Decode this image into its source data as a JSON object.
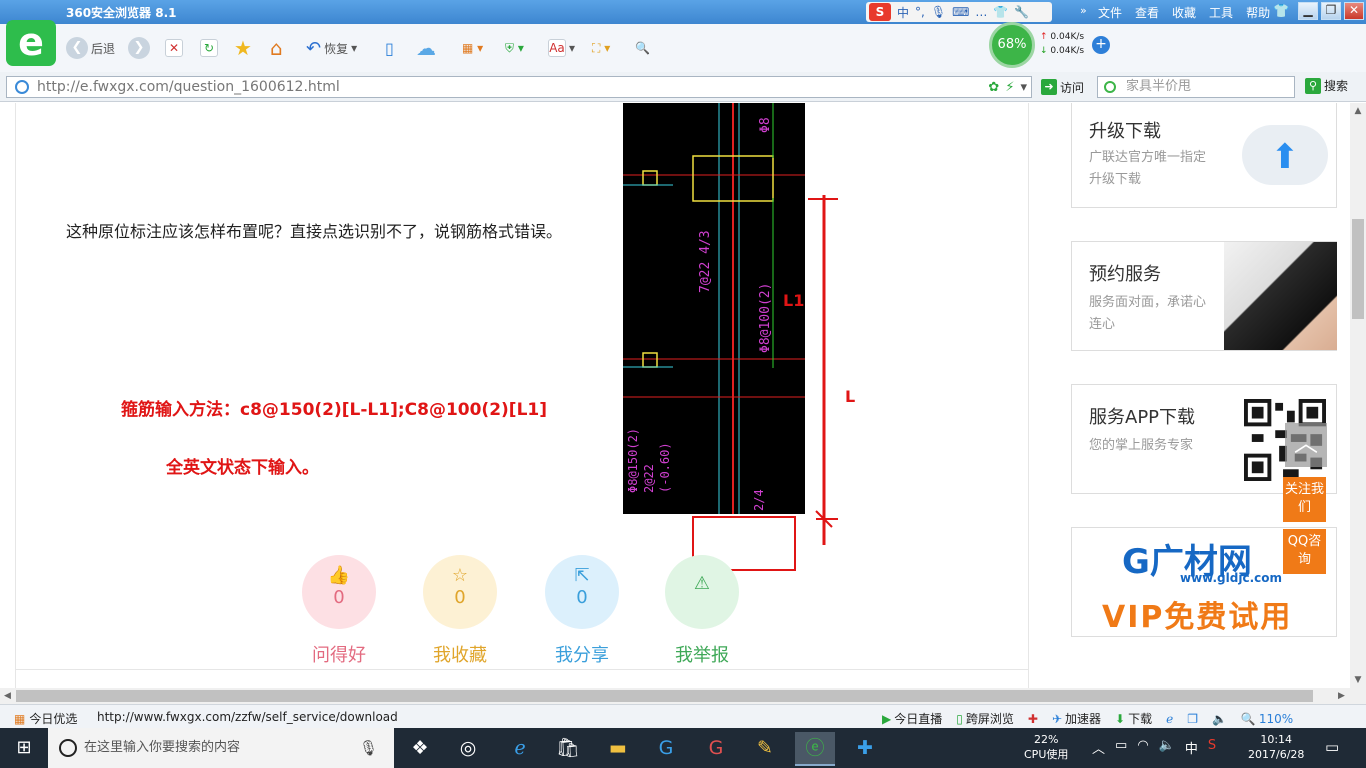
{
  "window": {
    "title": "360安全浏览器 8.1",
    "menus": [
      "文件",
      "查看",
      "收藏",
      "工具",
      "帮助"
    ],
    "controls": {
      "minimize": "▁",
      "maximize": "❐",
      "close": "✕"
    }
  },
  "ime": {
    "logo": "S",
    "mode": "中",
    "punct": "°,",
    "mic": "🎙",
    "keyboard": "⌨",
    "more": "…",
    "shirt": "👕",
    "tool": "🔧"
  },
  "toolbar": {
    "back_label": "后退",
    "restore_label": "恢复",
    "cpu_gauge": "68%",
    "net_up": "0.04K/s",
    "net_down": "0.04K/s"
  },
  "address": {
    "url": "http://e.fwxgx.com/question_1600612.html",
    "go_label": "访问",
    "search_placeholder": "家具半价甩",
    "search_button": "搜索"
  },
  "content": {
    "question_text": "这种原位标注应该怎样布置呢？直接点选识别不了，说钢筋格式错误。",
    "annotation_l1": "L1",
    "annotation_l": "L",
    "method_text": "箍筋输入方法：c8@150(2)[L-L1];C8@100(2)[L1]",
    "english_note": "全英文状态下输入。",
    "actions": [
      {
        "label": "问得好",
        "count": "0",
        "icon": "👍"
      },
      {
        "label": "我收藏",
        "count": "0",
        "icon": "☆"
      },
      {
        "label": "我分享",
        "count": "0",
        "icon": "⇱"
      },
      {
        "label": "我举报",
        "count": "",
        "icon": "⚠"
      }
    ]
  },
  "sidebar": {
    "upgrade": {
      "title": "升级下载",
      "desc": "广联达官方唯一指定升级下载"
    },
    "service": {
      "title": "预约服务",
      "desc": "服务面对面，承诺心连心"
    },
    "app": {
      "title": "服务APP下载",
      "desc": "您的掌上服务专家"
    },
    "ad": {
      "logo": "G广材网",
      "url": "www.gldjc.com",
      "vip": "VIP免费试用"
    },
    "float_top": "︿",
    "float_follow": "关注我们",
    "float_qq": "QQ咨询"
  },
  "status": {
    "today_picks": "今日优选",
    "hover_url": "http://www.fwxgx.com/zzfw/self_service/download",
    "live": "今日直播",
    "cross_screen": "跨屏浏览",
    "accelerator": "加速器",
    "download": "下载",
    "zoom": "110%"
  },
  "taskbar": {
    "search_placeholder": "在这里输入你要搜索的内容",
    "cpu_percent": "22%",
    "cpu_label": "CPU使用",
    "ime_indicator": "中",
    "time": "10:14",
    "date": "2017/6/28"
  }
}
